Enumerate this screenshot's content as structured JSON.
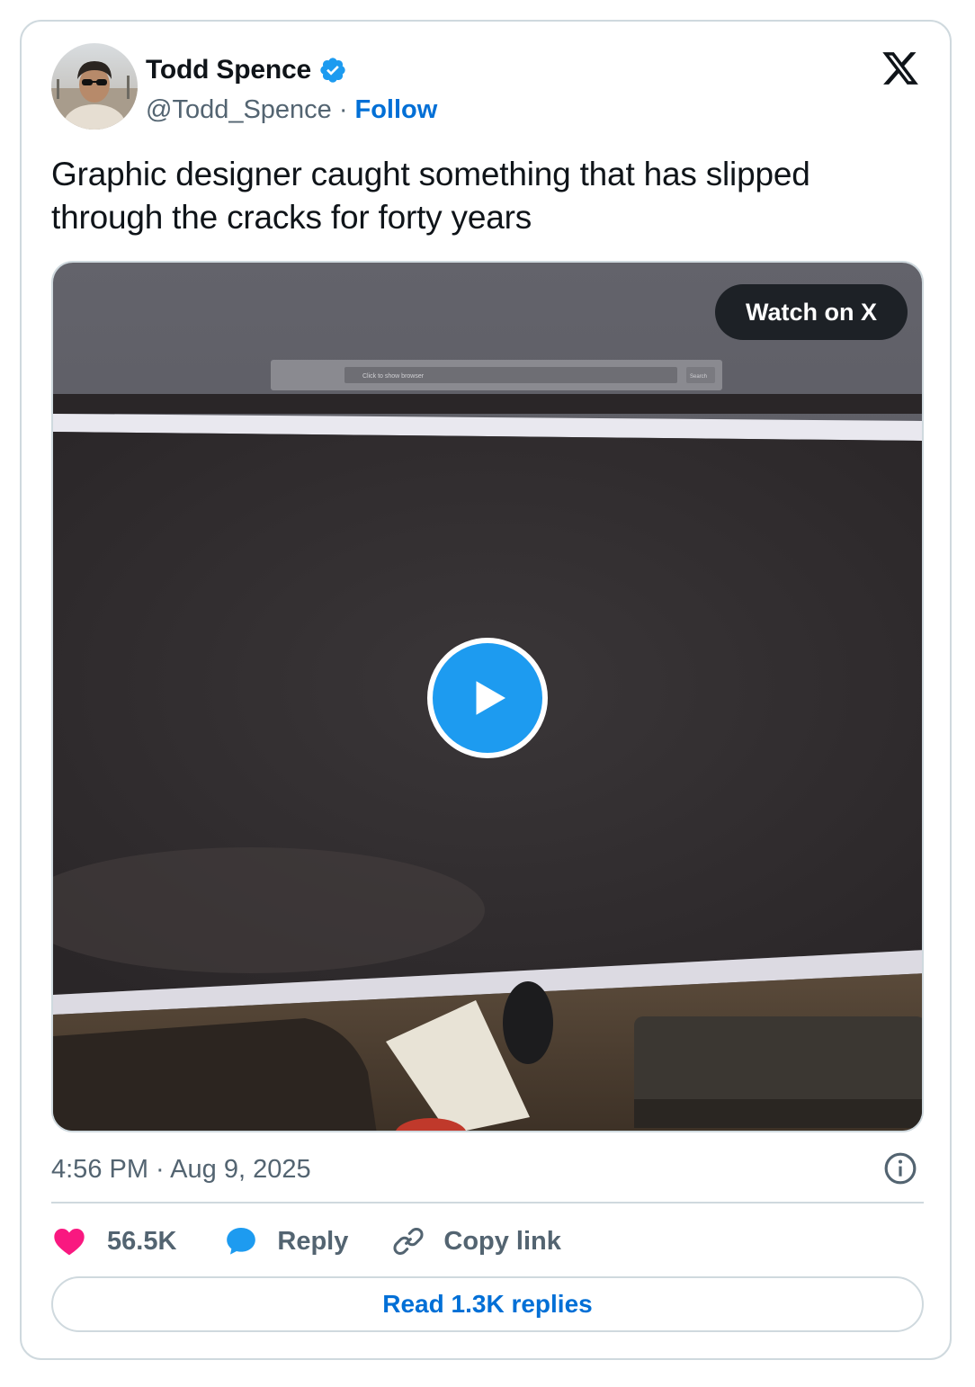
{
  "author": {
    "name": "Todd Spence",
    "handle": "@Todd_Spence",
    "separator": "·",
    "follow_label": "Follow",
    "verified": true
  },
  "tweet": {
    "text": "Graphic designer caught something that has slipped through the cracks for forty years"
  },
  "media": {
    "watch_label": "Watch on X",
    "play_icon": "play-icon",
    "browser_bar_placeholder": "Click to show browser",
    "browser_bar_button": "Search"
  },
  "meta": {
    "timestamp": "4:56 PM · Aug 9, 2025"
  },
  "actions": {
    "like_count": "56.5K",
    "reply_label": "Reply",
    "copy_label": "Copy link"
  },
  "read_replies_label": "Read 1.3K replies",
  "colors": {
    "accent": "#1d9bf0",
    "link": "#006fd6",
    "like": "#f91880",
    "muted": "#536471",
    "border": "#cfd9de"
  }
}
